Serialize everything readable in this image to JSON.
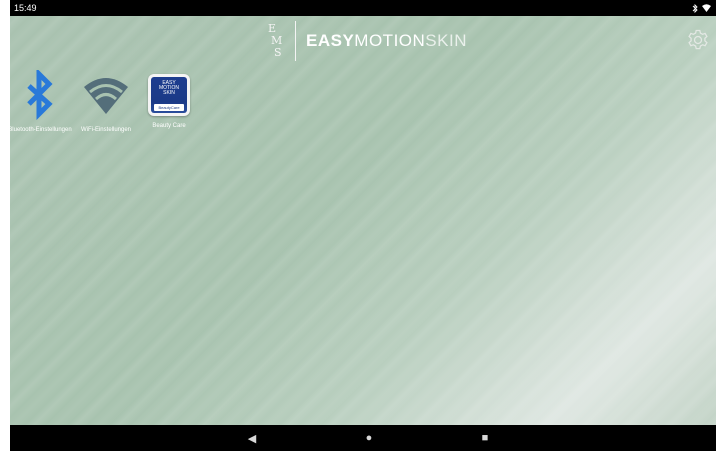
{
  "status_bar": {
    "time": "15:49",
    "icons": [
      "bluetooth-icon",
      "wifi-icon"
    ]
  },
  "header": {
    "logo_letters": [
      "E",
      "M",
      "S"
    ],
    "brand_part1": "EASY",
    "brand_part2": "MOTION",
    "brand_part3": "SKIN"
  },
  "settings": {
    "icon": "gear-icon"
  },
  "apps": [
    {
      "label": "Bluetooth-Einstellungen",
      "icon": "bluetooth-icon",
      "color": "#2979d9"
    },
    {
      "label": "WiFi-Einstellungen",
      "icon": "wifi-icon",
      "color": "#546e7a"
    },
    {
      "label": "Beauty Care",
      "icon": "beauty-care-icon",
      "logo_text": [
        "EASY",
        "MOTION",
        "SKIN"
      ],
      "badge": "BeautyCare"
    }
  ],
  "nav_bar": {
    "back": "◀",
    "home": "●",
    "recents": "■"
  },
  "colors": {
    "wallpaper": "#a8c2b0",
    "bars": "#000000",
    "bluetooth": "#2979d9",
    "wifi": "#546e7a",
    "beauty_blue": "#1b3a87"
  }
}
